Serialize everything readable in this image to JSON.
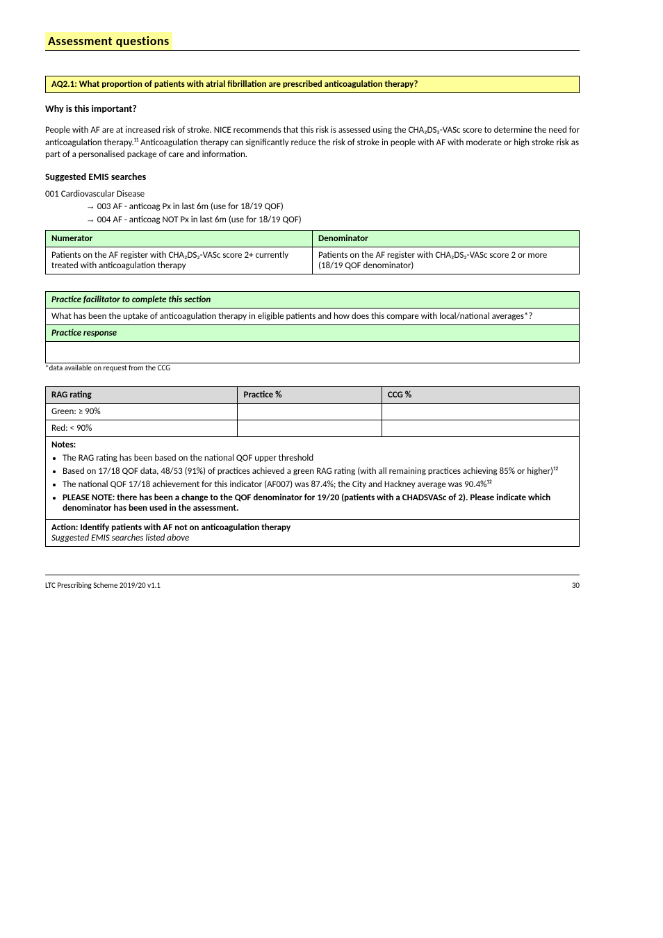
{
  "title": "Assessment questions",
  "aq_header": "AQ2.1: What proportion of patients with atrial fibrillation are prescribed anticoagulation therapy?",
  "why_heading": "Why is this important?",
  "why_para": "People with AF are at increased risk of stroke. NICE recommends that this risk is assessed using the CHA₂DS₂-VASc score to determine the need for anticoagulation therapy.¹¹ Anticoagulation therapy can significantly reduce the risk of stroke in people with AF with moderate or high stroke risk as part of a personalised package of care and information.",
  "search_heading": "Suggested EMIS searches",
  "search_prefix": "001 Cardiovascular Disease",
  "search_item_a": "003 AF - anticoag Px in last 6m (use for 18/19 QOF)",
  "search_item_b": "004 AF - anticoag NOT Px in last 6m (use for 18/19 QOF)",
  "tbl1": {
    "head": [
      "Numerator",
      "Denominator"
    ],
    "row_num": "Patients on the AF register with CHA₂DS₂-VASc score 2+ currently treated with anticoagulation therapy",
    "row_den": "Patients on the AF register with CHA₂DS₂-VASc score 2 or more (18/19 QOF denominator)"
  },
  "tbl2": {
    "head1": "Practice facilitator to complete this section",
    "q1": "What has been the uptake of anticoagulation therapy in eligible patients and how does this compare with local/national averages*?",
    "head2": "Practice response",
    "row2": ""
  },
  "star_note": "*data available on request from the CCG",
  "tbl3": {
    "head": [
      "RAG rating",
      "Practice %",
      "CCG %"
    ],
    "rows": [
      [
        "Green: ≥ 90%",
        "",
        ""
      ],
      [
        "Red: < 90%",
        "",
        ""
      ]
    ],
    "notes_label": "Notes:",
    "notes": [
      "The RAG rating has been based on the national QOF upper threshold",
      "Based on 17/18 QOF data, 48/53 (91%) of practices achieved a green RAG rating (with all remaining practices achieving 85% or higher)¹²",
      "The national QOF 17/18 achievement for this indicator (AF007) was 87.4%; the City and Hackney average was 90.4%¹²",
      "PLEASE NOTE: there has been a change to the QOF denominator for 19/20 (patients with a CHADSVASc of 2). Please indicate which denominator has been used in the assessment."
    ],
    "actions_label": "Action: Identify patients with AF not on anticoagulation therapy",
    "actions_note": "Suggested EMIS searches listed above"
  },
  "footer": {
    "left": "LTC Prescribing Scheme 2019/20 v1.1",
    "right": "30"
  }
}
